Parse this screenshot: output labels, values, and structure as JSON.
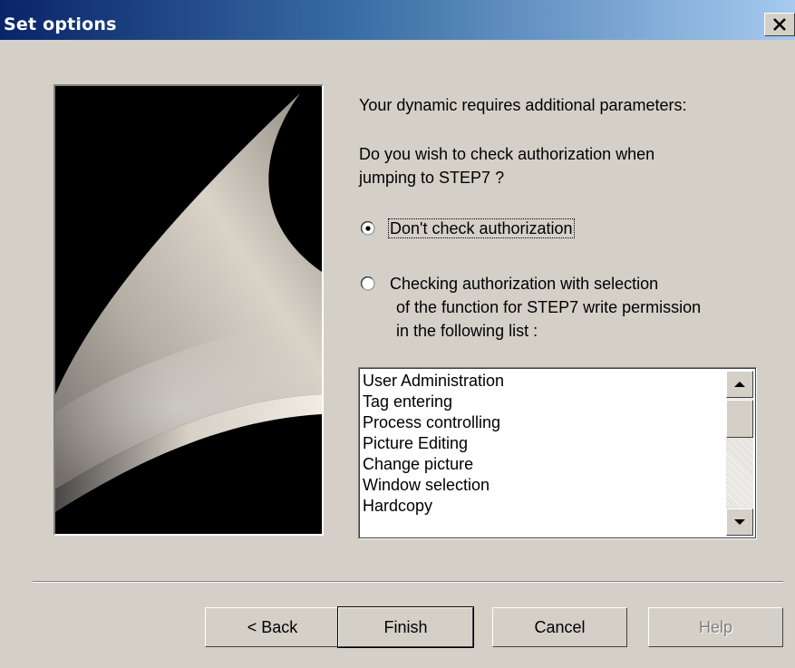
{
  "window": {
    "title": "Set options",
    "close_icon": "close-icon"
  },
  "image": {
    "icon": "decorative-wizard-artwork"
  },
  "content": {
    "intro": "Your dynamic requires additional parameters:",
    "question_line1": "Do you wish to check authorization when",
    "question_line2": "jumping to STEP7 ?",
    "option1_label": "Don't check authorization",
    "option1_selected": true,
    "option2_line1": "Checking authorization with selection",
    "option2_line2": "of the function for STEP7 write permission",
    "option2_line3": "in the following list :",
    "option2_selected": false
  },
  "permissions_list": {
    "items": [
      "User Administration",
      "Tag entering",
      "Process controlling",
      "Picture Editing",
      "Change picture",
      "Window selection",
      "Hardcopy"
    ]
  },
  "buttons": {
    "back": "< Back",
    "finish": "Finish",
    "cancel": "Cancel",
    "help": "Help",
    "help_enabled": false
  },
  "colors": {
    "title_gradient_start": "#0a246a",
    "title_gradient_end": "#a6caf0",
    "face": "#d4d0c8"
  }
}
